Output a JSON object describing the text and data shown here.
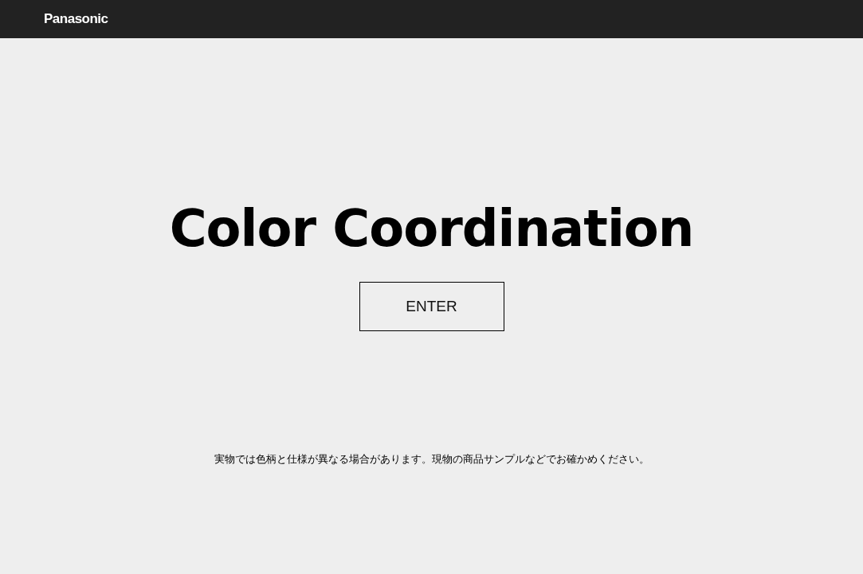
{
  "header": {
    "logo": "Panasonic"
  },
  "title": "Color Coordination",
  "enter_button": "ENTER",
  "notice": "実物では色柄と仕様が異なる場合があります。現物の商品サンプルなどでお確かめください。"
}
